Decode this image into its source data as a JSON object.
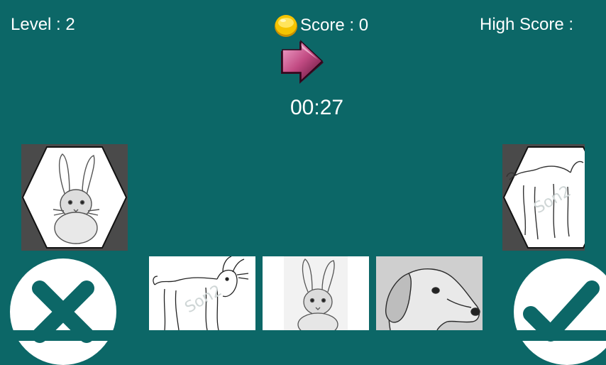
{
  "hud": {
    "level_text": "Level : 2",
    "score_text": "Score : 0",
    "high_score_text": "High Score :",
    "timer_text": "00:27"
  },
  "colors": {
    "background": "#0c6767",
    "card_frame": "#4a4a4a",
    "arrow": "#c0407a",
    "coin": "#f5c400",
    "button_face": "#ffffff",
    "button_mark": "#0c6767"
  },
  "icons": {
    "coin": "coin-icon",
    "next": "next-arrow-icon",
    "wrong": "cross-icon",
    "correct": "check-icon"
  },
  "cards": {
    "left": "rabbit",
    "right": "goat"
  },
  "choices": [
    "goat",
    "rabbit",
    "dog"
  ],
  "watermark": "Son2"
}
